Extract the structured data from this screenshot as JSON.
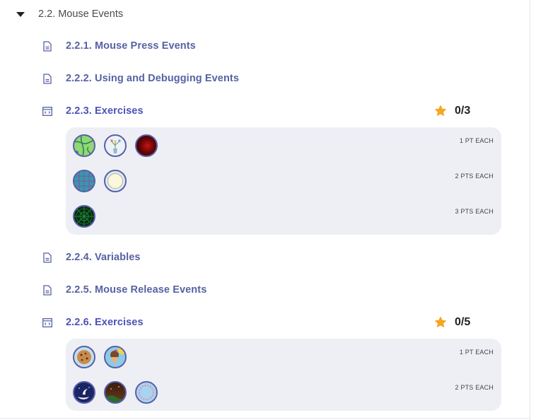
{
  "section": {
    "title": "2.2. Mouse Events"
  },
  "items": [
    {
      "label": "2.2.1. Mouse Press Events",
      "icon": "document-icon"
    },
    {
      "label": "2.2.2. Using and Debugging Events",
      "icon": "document-icon"
    },
    {
      "label": "2.2.3. Exercises",
      "icon": "code-window-icon",
      "score": "0/3"
    },
    {
      "label": "2.2.4. Variables",
      "icon": "document-icon"
    },
    {
      "label": "2.2.5. Mouse Release Events",
      "icon": "document-icon"
    },
    {
      "label": "2.2.6. Exercises",
      "icon": "code-window-icon",
      "score": "0/5"
    }
  ],
  "exercise_panels": [
    {
      "rows": [
        {
          "points": "1 PT EACH",
          "badges": [
            "green-map-badge",
            "flower-vase-badge",
            "red-glow-badge"
          ]
        },
        {
          "points": "2 PTS EACH",
          "badges": [
            "teal-grid-badge",
            "cream-circle-badge"
          ]
        },
        {
          "points": "3 PTS EACH",
          "badges": [
            "green-web-badge"
          ]
        }
      ]
    },
    {
      "rows": [
        {
          "points": "1 PT EACH",
          "badges": [
            "cookie-badge",
            "ice-cream-badge"
          ]
        },
        {
          "points": "2 PTS EACH",
          "badges": [
            "night-moon-badge",
            "brown-hill-badge",
            "dotted-ring-badge"
          ]
        }
      ]
    }
  ],
  "colors": {
    "link": "#5762a3",
    "exercise_link": "#4d52b8",
    "star": "#f5a623",
    "panel": "#eeeff5",
    "badge_border": "#5b5fa8"
  }
}
